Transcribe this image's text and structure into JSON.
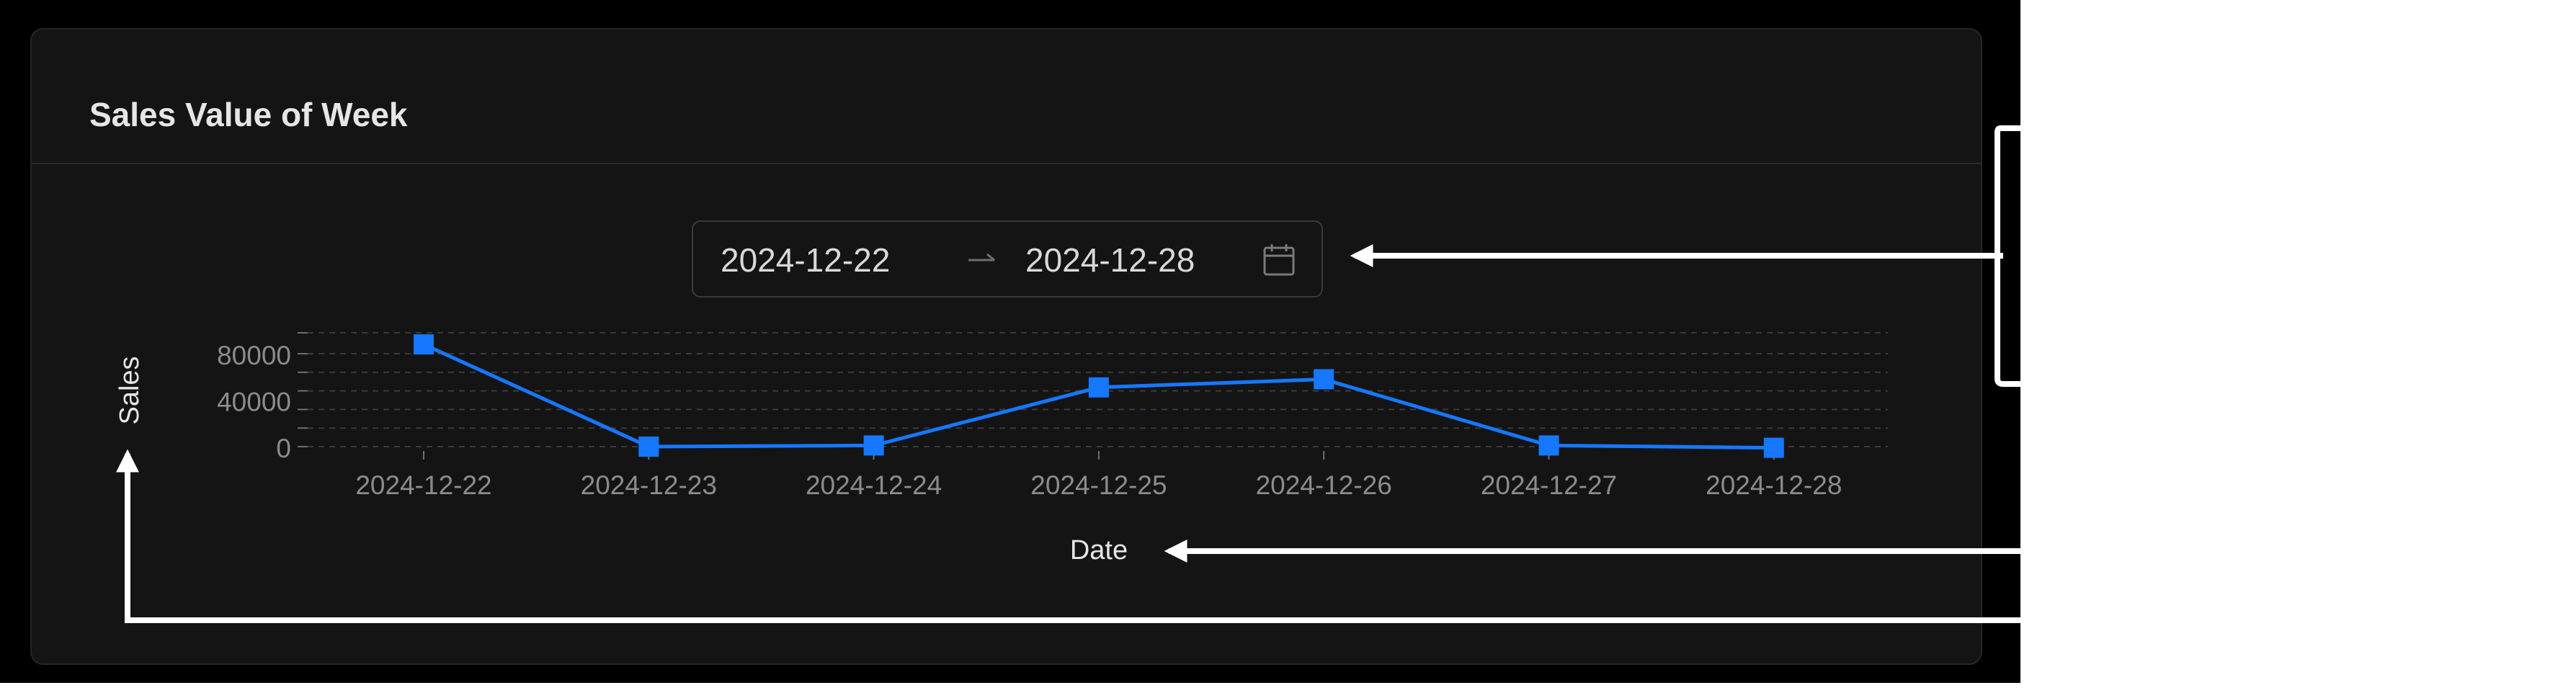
{
  "card": {
    "title": "Sales Value of Week"
  },
  "date_range": {
    "start": "2024-12-22",
    "end": "2024-12-28",
    "separator_icon": "arrow-right-icon",
    "calendar_icon": "calendar-icon"
  },
  "chart_data": {
    "type": "line",
    "xlabel": "Date",
    "ylabel": "Sales",
    "categories": [
      "2024-12-22",
      "2024-12-23",
      "2024-12-24",
      "2024-12-25",
      "2024-12-26",
      "2024-12-27",
      "2024-12-28"
    ],
    "series": [
      {
        "values": [
          88000,
          0,
          1000,
          51000,
          58000,
          1000,
          -1000
        ],
        "color": "#1677ff"
      }
    ],
    "yticks": [
      "80000",
      "40000",
      "0"
    ],
    "ylim": [
      -2000,
      100000
    ],
    "grid": true
  },
  "colors": {
    "background": "#000000",
    "card": "#141414",
    "accent": "#1677ff",
    "text_muted": "#8c8c8c",
    "annotation": "#ffffff"
  }
}
